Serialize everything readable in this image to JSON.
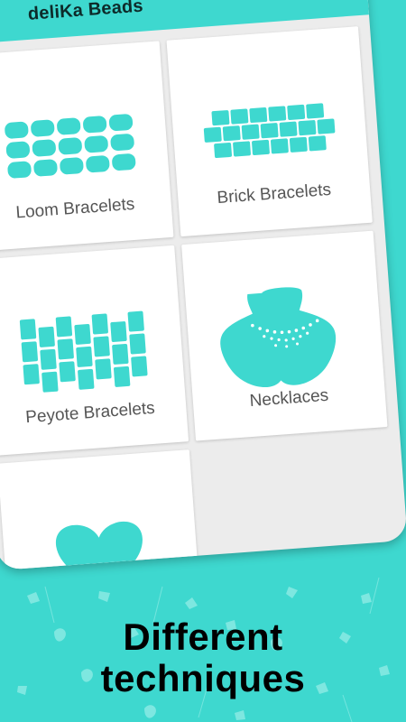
{
  "app": {
    "title": "deliKa Beads"
  },
  "icons": {
    "menu": "hamburger-menu-icon",
    "accent": "#3ed8cf"
  },
  "cards": [
    {
      "label": "Loom Bracelets",
      "icon": "loom-pattern-icon"
    },
    {
      "label": "Brick Bracelets",
      "icon": "brick-pattern-icon"
    },
    {
      "label": "Peyote Bracelets",
      "icon": "peyote-pattern-icon"
    },
    {
      "label": "Necklaces",
      "icon": "necklace-bust-icon"
    },
    {
      "label": "",
      "icon": "heart-icon"
    }
  ],
  "promo": {
    "line1": "Different",
    "line2": "techniques"
  },
  "colors": {
    "accent": "#3ed8cf",
    "card": "#ffffff",
    "background": "#ececec",
    "text": "#555555"
  }
}
